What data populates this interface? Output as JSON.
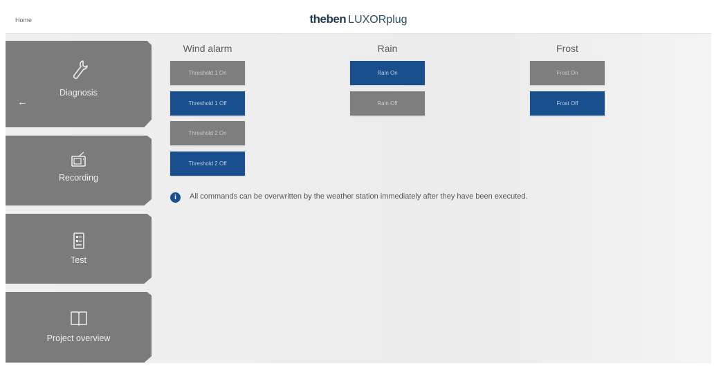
{
  "topbar": {
    "home_label": "Home",
    "brand_part1": "theben",
    "brand_part2": "LUXORplug"
  },
  "sidebar": {
    "back_icon": "left-arrow",
    "items": [
      {
        "label": "Diagnosis",
        "icon": "wrench-icon"
      },
      {
        "label": "Recording",
        "icon": "tv-icon"
      },
      {
        "label": "Test",
        "icon": "checklist-icon"
      },
      {
        "label": "Project overview",
        "icon": "book-icon"
      }
    ]
  },
  "columns": [
    {
      "title": "Wind alarm",
      "buttons": [
        {
          "label": "Threshold 1 On",
          "active": false
        },
        {
          "label": "Threshold 1 Off",
          "active": true
        },
        {
          "label": "Threshold 2 On",
          "active": false
        },
        {
          "label": "Threshold 2 Off",
          "active": true
        }
      ]
    },
    {
      "title": "Rain",
      "buttons": [
        {
          "label": "Rain On",
          "active": true
        },
        {
          "label": "Rain Off",
          "active": false
        }
      ]
    },
    {
      "title": "Frost",
      "buttons": [
        {
          "label": "Frost On",
          "active": false
        },
        {
          "label": "Frost Off",
          "active": true
        }
      ]
    }
  ],
  "info": {
    "icon": "info-icon",
    "text": "All commands can be overwritten by the weather station immediately after they have been executed."
  },
  "colors": {
    "active_button": "#1a4f8d",
    "inactive_button": "#7e7e7e",
    "sidebar_tab": "#7b7b7b"
  }
}
